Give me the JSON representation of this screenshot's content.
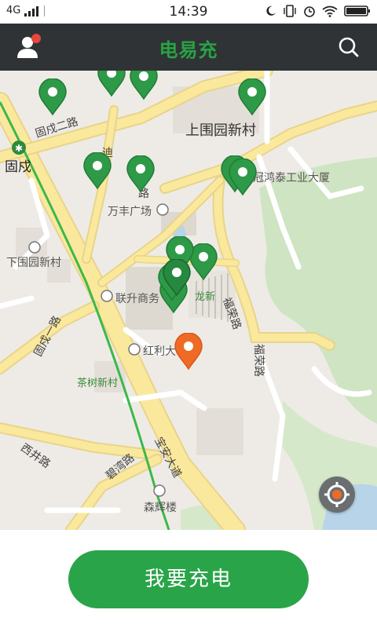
{
  "status_bar": {
    "network": "4G",
    "time": "14:39"
  },
  "header": {
    "title": "电易充",
    "notification_color": "#e8473b"
  },
  "map": {
    "place_labels": {
      "shangweiyuan": "上围园新村",
      "guxu": "固戍",
      "guanhongtai": "冠鸿泰工业大厦",
      "wanfeng": "万丰广场",
      "xiaweiyuan": "下围园新村",
      "liansheng": "联升商务",
      "longxin": "龙新",
      "hongli": "红利大",
      "chashu": "茶树新村",
      "senhui": "森辉楼"
    },
    "road_labels": {
      "guxu_er": "固戍二路",
      "di": "迪",
      "xin_lu": "新",
      "lu_char": "路",
      "furong_1": "福荣路",
      "furong_2": "福荣路",
      "guxu_yi": "固戍一路",
      "xijing": "西井路",
      "biwan": "碧湾路",
      "baoan": "宝安大道"
    },
    "charger_pin_color": "#2e9a48",
    "selected_pin_color": "#ef6a25",
    "metro_line_color": "#3cb84a",
    "metro_icon": "metro-station-icon",
    "locate_icon": "locate-icon"
  },
  "action": {
    "charge_label": "我要充电",
    "color": "#2aa449"
  }
}
